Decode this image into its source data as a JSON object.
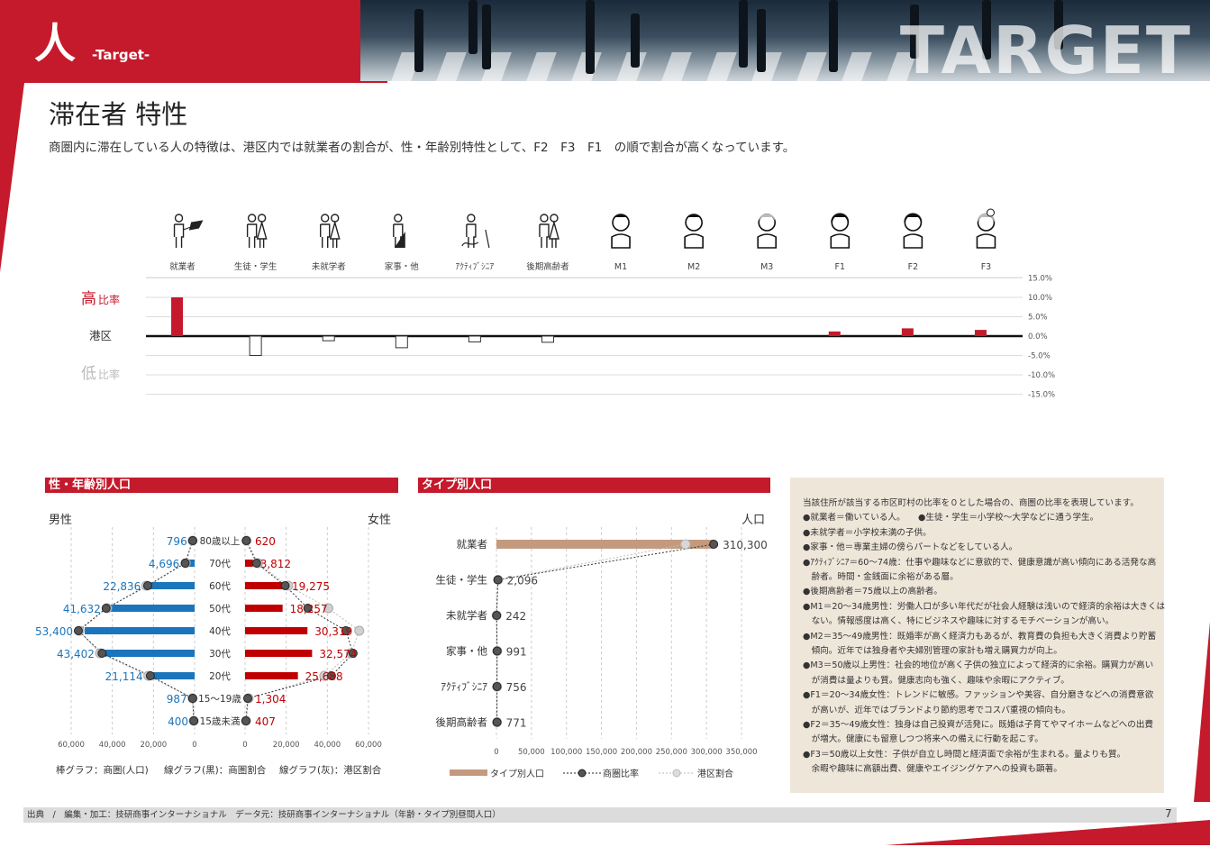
{
  "header": {
    "kanji": "人",
    "kanji_sub": "-Target-",
    "watermark": "TARGET"
  },
  "title": "滞在者 特性",
  "subtitle": "商圏内に滞在している人の特徴は、港区内では就業者の割合が、性・年齢別特性として、F2　F3　F1　の順で割合が高くなっています。",
  "colors": {
    "accent": "#c41a2b",
    "male": "#1b75bc",
    "female": "#c00000",
    "type_bar": "#c49a7e",
    "ratio_black": "#333333",
    "ratio_gray": "#bdbdbd"
  },
  "chart_data": [
    {
      "type": "bar",
      "id": "ratio",
      "categories": [
        "就業者",
        "生徒・学生",
        "未就学者",
        "家事・他",
        "ｱｸﾃｨﾌﾞｼﾆｱ",
        "後期高齢者",
        "M1",
        "M2",
        "M3",
        "F1",
        "F2",
        "F3"
      ],
      "icons": [
        "worker-icon",
        "student-icon",
        "child-icon",
        "housework-icon",
        "active-senior-icon",
        "elderly-icon",
        "m1-icon",
        "m2-icon",
        "m3-icon",
        "f1-icon",
        "f2-icon",
        "f3-icon"
      ],
      "values": [
        10.0,
        -5.0,
        -1.2,
        -3.0,
        -1.5,
        -1.6,
        0,
        0,
        0,
        1.2,
        2.0,
        1.6
      ],
      "ylim": [
        -15,
        15
      ],
      "yticks": [
        "15.0%",
        "10.0%",
        "5.0%",
        "0.0%",
        "-5.0%",
        "-10.0%",
        "-15.0%"
      ],
      "label_high": "高",
      "label_high_suffix": "比率",
      "label_base": "港区",
      "label_low": "低",
      "label_low_suffix": "比率"
    },
    {
      "type": "bar",
      "id": "pyramid",
      "title": "性・年齢別人口",
      "male_label": "男性",
      "female_label": "女性",
      "categories": [
        "80歳以上",
        "70代",
        "60代",
        "50代",
        "40代",
        "30代",
        "20代",
        "15〜19歳",
        "15歳未満"
      ],
      "male_values": [
        796,
        4696,
        22836,
        41632,
        53400,
        43402,
        21114,
        987,
        400
      ],
      "female_values": [
        620,
        3812,
        19275,
        18257,
        30319,
        32574,
        25688,
        1304,
        407
      ],
      "male_labels": [
        "796",
        "4,696",
        "22,836",
        "41,632",
        "53,400",
        "43,402",
        "21,114",
        "987",
        "400"
      ],
      "female_labels": [
        "620",
        "3,812",
        "19,275",
        "18,257",
        "30,319",
        "32,574",
        "25,688",
        "1,304",
        "407"
      ],
      "male_black_line": [
        900,
        4600,
        22800,
        43000,
        56500,
        45000,
        21500,
        950,
        380
      ],
      "male_gray_line": [
        1000,
        4300,
        23500,
        42500,
        56000,
        46000,
        22500,
        1000,
        420
      ],
      "female_black_line": [
        600,
        5600,
        19500,
        30500,
        49000,
        52500,
        42000,
        1300,
        400
      ],
      "female_gray_line": [
        700,
        6300,
        21000,
        40500,
        55500,
        51500,
        38500,
        1700,
        500
      ],
      "xmax": 60000,
      "male_ticks": [
        "60,000",
        "40,000",
        "20,000",
        "0"
      ],
      "female_ticks": [
        "0",
        "20,000",
        "40,000",
        "60,000"
      ],
      "legend": [
        "棒グラフ：商圏(人口)",
        "線グラフ(黒)：商圏割合",
        "線グラフ(灰)：港区割合"
      ]
    },
    {
      "type": "bar",
      "id": "typepop",
      "title": "タイプ別人口",
      "unit": "人口",
      "categories": [
        "就業者",
        "生徒・学生",
        "未就学者",
        "家事・他",
        "ｱｸﾃｨﾌﾞｼﾆｱ",
        "後期高齢者"
      ],
      "values": [
        310300,
        2096,
        242,
        991,
        756,
        771
      ],
      "value_labels": [
        "310,300",
        "2,096",
        "242",
        "991",
        "756",
        "771"
      ],
      "black_line": [
        310300,
        2096,
        242,
        991,
        756,
        771
      ],
      "gray_line": [
        270000,
        2500,
        300,
        1200,
        900,
        900
      ],
      "xmax": 350000,
      "xticks": [
        "0",
        "50,000",
        "100,000",
        "150,000",
        "200,000",
        "250,000",
        "300,000",
        "350,000"
      ],
      "legend": [
        "タイプ別人口",
        "商圏比率",
        "港区割合"
      ]
    }
  ],
  "notes": [
    "当該住所が該当する市区町村の比率を０とした場合の、商圏の比率を表現しています。",
    "●就業者＝働いている人。　　●生徒・学生＝小学校〜大学などに通う学生。",
    "●未就学者＝小学校未満の子供。",
    "●家事・他＝専業主婦の傍らパートなどをしている人。",
    "●ｱｸﾃｨﾌﾞｼﾆｱ＝60〜74歳：仕事や趣味などに意欲的で、健康意識が高い傾向にある活発な高",
    "　齢者。時間・金銭面に余裕がある層。",
    "●後期高齢者＝75歳以上の高齢者。",
    "●M1＝20〜34歳男性：労働人口が多い年代だが社会人経験は浅いので経済的余裕は大きくは",
    "　ない。情報感度は高く、特にビジネスや趣味に対するモチベーションが高い。",
    "●M2＝35〜49歳男性：既婚率が高く経済力もあるが、教育費の負担も大きく消費より貯蓄",
    "　傾向。近年では独身者や夫婦別管理の家計も増え購買力が向上。",
    "●M3＝50歳以上男性：社会的地位が高く子供の独立によって経済的に余裕。購買力が高い",
    "　が消費は量よりも質。健康志向も強く、趣味や余暇にアクティブ。",
    "●F1＝20〜34歳女性：トレンドに敏感。ファッションや美容、自分磨きなどへの消費意欲",
    "　が高いが、近年ではブランドより節約思考でコスパ重視の傾向も。",
    "●F2＝35〜49歳女性：独身は自己投資が活発に。既婚は子育てやマイホームなどへの出費",
    "　が増大。健康にも留意しつつ将来への備えに行動を起こす。",
    "●F3＝50歳以上女性：子供が自立し時間と経済面で余裕が生まれる。量よりも質。",
    "　余暇や趣味に高額出費、健康やエイジングケアへの投資も顕著。"
  ],
  "footer": "出典　/　編集・加工：技研商事インターナショナル　データ元：技研商事インターナショナル（年齢・タイプ別昼間人口）",
  "page_number": "7"
}
